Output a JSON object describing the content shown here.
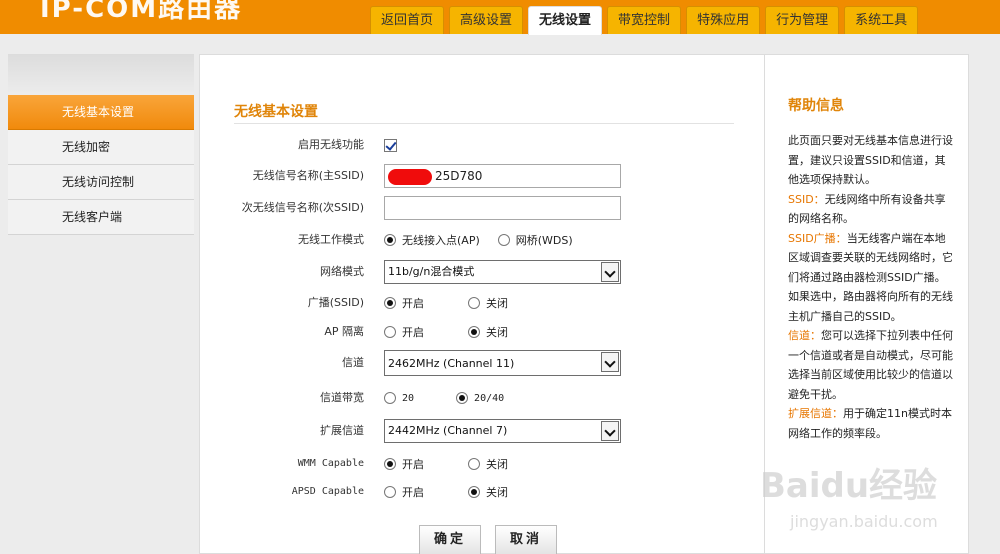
{
  "header": {
    "logo_text": "IP-COM路由器",
    "tabs": [
      "返回首页",
      "高级设置",
      "无线设置",
      "带宽控制",
      "特殊应用",
      "行为管理",
      "系统工具"
    ],
    "active_tab": 2
  },
  "sidebar": {
    "items": [
      "无线基本设置",
      "无线加密",
      "无线访问控制",
      "无线客户端"
    ],
    "active": 0
  },
  "form": {
    "title": "无线基本设置",
    "enable_wireless": {
      "label": "启用无线功能",
      "checked": true
    },
    "ssid_main": {
      "label": "无线信号名称(主SSID)",
      "value": "25D780"
    },
    "ssid_secondary": {
      "label": "次无线信号名称(次SSID)",
      "value": ""
    },
    "work_mode": {
      "label": "无线工作模式",
      "options": [
        "无线接入点(AP)",
        "网桥(WDS)"
      ],
      "selected": 0
    },
    "network_mode": {
      "label": "网络模式",
      "value": "11b/g/n混合模式"
    },
    "broadcast": {
      "label": "广播(SSID)",
      "options": [
        "开启",
        "关闭"
      ],
      "selected": 0
    },
    "ap_isolation": {
      "label": "AP 隔离",
      "options": [
        "开启",
        "关闭"
      ],
      "selected": 1
    },
    "channel": {
      "label": "信道",
      "value": "2462MHz (Channel 11)"
    },
    "bandwidth": {
      "label": "信道带宽",
      "options": [
        "20",
        "20/40"
      ],
      "selected": 1
    },
    "ext_channel": {
      "label": "扩展信道",
      "value": "2442MHz (Channel 7)"
    },
    "wmm": {
      "label": "WMM Capable",
      "options": [
        "开启",
        "关闭"
      ],
      "selected": 0
    },
    "apsd": {
      "label": "APSD Capable",
      "options": [
        "开启",
        "关闭"
      ],
      "selected": 1
    },
    "ok_label": "确定",
    "cancel_label": "取消"
  },
  "help": {
    "title": "帮助信息",
    "intro": "此页面只要对无线基本信息进行设置，建议只设置SSID和信道，其他选项保持默认。",
    "ssid_term": "SSID：",
    "ssid_desc": "无线网络中所有设备共享的网络名称。",
    "broadcast_term": "SSID广播：",
    "broadcast_desc": "当无线客户端在本地区域调查要关联的无线网络时，它们将通过路由器检测SSID广播。 如果选中，路由器将向所有的无线主机广播自己的SSID。",
    "channel_term": "信道：",
    "channel_desc": "您可以选择下拉列表中任何一个信道或者是自动模式，尽可能选择当前区域使用比较少的信道以避免干扰。",
    "ext_term": "扩展信道：",
    "ext_desc": "用于确定11n模式时本网络工作的频率段。"
  },
  "watermark": {
    "brand": "Baidu经验",
    "url": "jingyan.baidu.com"
  },
  "colors": {
    "accent": "#f08c00",
    "tab": "#f6b400",
    "highlight": "#e77600",
    "sidebar_active": "#f18a0c"
  }
}
